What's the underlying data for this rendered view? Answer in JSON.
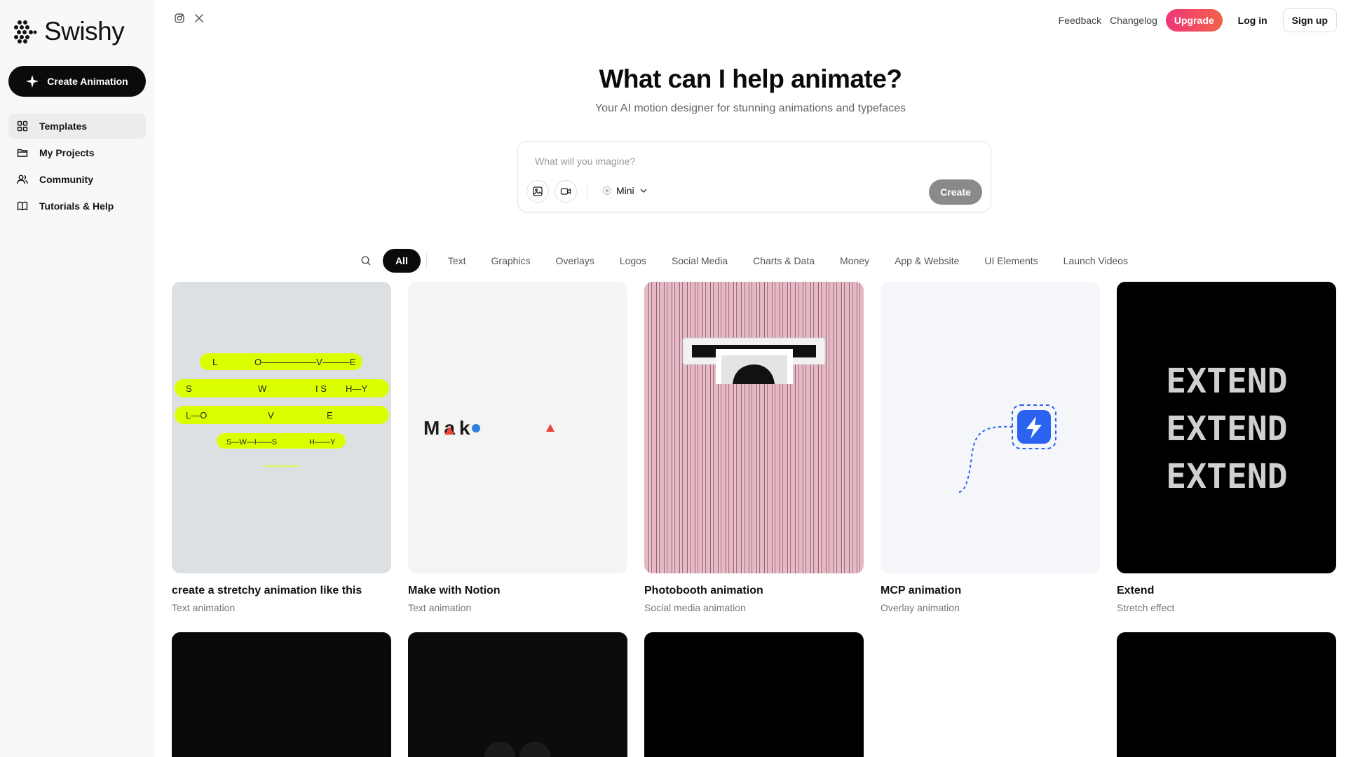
{
  "brand": {
    "name": "Swishy"
  },
  "sidebar": {
    "create_label": "Create Animation",
    "items": [
      {
        "label": "Templates",
        "icon": "grid-icon"
      },
      {
        "label": "My Projects",
        "icon": "folder-icon"
      },
      {
        "label": "Community",
        "icon": "users-icon"
      },
      {
        "label": "Tutorials & Help",
        "icon": "book-icon"
      }
    ]
  },
  "topbar": {
    "feedback": "Feedback",
    "changelog": "Changelog",
    "upgrade": "Upgrade",
    "login": "Log in",
    "signup": "Sign up"
  },
  "hero": {
    "title": "What can I help animate?",
    "subtitle": "Your AI motion designer for stunning animations and typefaces"
  },
  "prompt": {
    "placeholder": "What will you imagine?",
    "model": "Mini",
    "create": "Create"
  },
  "categories": [
    "All",
    "Text",
    "Graphics",
    "Overlays",
    "Logos",
    "Social Media",
    "Charts & Data",
    "Money",
    "App & Website",
    "UI Elements",
    "Launch Videos"
  ],
  "cards": [
    {
      "title": "create a stretchy animation like this",
      "subtitle": "Text animation"
    },
    {
      "title": "Make with Notion",
      "subtitle": "Text animation"
    },
    {
      "title": "Photobooth animation",
      "subtitle": "Social media animation"
    },
    {
      "title": "MCP animation",
      "subtitle": "Overlay animation"
    },
    {
      "title": "Extend",
      "subtitle": "Stretch effect"
    }
  ],
  "thumb_text": {
    "stretch_rows": [
      [
        "L",
        "O——————V———E"
      ],
      [
        "S",
        "W",
        "I  S",
        "H—Y"
      ],
      [
        "L—O",
        "V",
        "E"
      ],
      [
        "S—W—I——S",
        "H——Y"
      ]
    ],
    "notion": "Mak",
    "extend": "EXTEND"
  },
  "colors": {
    "accent": "#0b0b0b",
    "upgrade_start": "#f0367a",
    "upgrade_end": "#f2624a",
    "lime": "#dcff00",
    "mcp_blue": "#2b63f0"
  }
}
